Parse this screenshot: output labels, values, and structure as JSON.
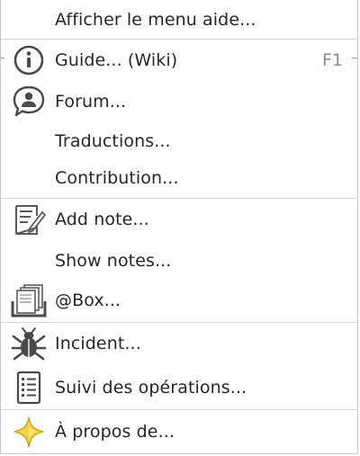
{
  "menu": {
    "items": [
      {
        "label": "Afficher le menu aide...",
        "icon": null
      },
      {
        "label": "Guide... (Wiki)",
        "shortcut": "F1",
        "icon": "info-icon"
      },
      {
        "label": "Forum...",
        "icon": "forum-chat-icon"
      },
      {
        "label": "Traductions...",
        "icon": null
      },
      {
        "label": "Contribution...",
        "icon": null
      },
      {
        "label": "Add note...",
        "icon": "note-edit-icon"
      },
      {
        "label": "Show notes...",
        "icon": null
      },
      {
        "label": "@Box...",
        "icon": "documents-box-icon"
      },
      {
        "label": "Incident...",
        "icon": "bug-icon"
      },
      {
        "label": "Suivi des opérations...",
        "icon": "list-icon"
      },
      {
        "label": "À propos de...",
        "icon": "star-icon"
      }
    ]
  },
  "colors": {
    "text": "#262626",
    "shortcut": "#8a8a8a",
    "separator": "#d6d6d6",
    "star": "#f5d33a"
  }
}
